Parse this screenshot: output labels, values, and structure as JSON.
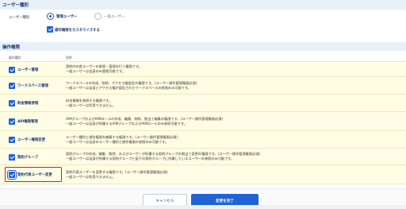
{
  "user_type": {
    "section_title": "ユーザー種別",
    "field_label": "ユーザー種別",
    "options": [
      {
        "label": "管理ユーザー",
        "selected": true
      },
      {
        "label": "一般ユーザー",
        "selected": false
      }
    ],
    "customize_label": "操作権限をカスタマイズする"
  },
  "permissions": {
    "section_title": "操作権限",
    "col_type": "操作種別",
    "col_desc": "説明",
    "rows": [
      {
        "name": "ユーザー管理",
        "desc": [
          "契約内の各ユーザーの参照・管理を行う権限です。",
          "一般ユーザーは自身のみ管理可能です。"
        ]
      },
      {
        "name": "ワークスペース管理",
        "desc": [
          "ワークスペースの作成、削除、アクセス権設定の権限です。(ユーザー操作管理権限必須)",
          "一般ユーザーは自身とアクセス権が設定されたワークスペースの参照のみ可能です。"
        ]
      },
      {
        "name": "料金情報参照",
        "desc": [
          "料金情報を参照する権限です。",
          "一般ユーザーは利用できません。"
        ]
      },
      {
        "name": "API権限管理",
        "desc": [
          "IAMグループおよびIAMロールの作成、編集、削除、割当て編集の権限です。(ユーザー操作管理権限必須)",
          "一般ユーザーは自身が所属するIAMグループおよびIAMロールのみ参照可能です。"
        ]
      },
      {
        "name": "ユーザー権限変更",
        "desc": [
          "ユーザー種別と操作権限を編集する権限です。(ユーザー操作管理権限必須)",
          "一般ユーザーは自身のユーザー種別と操作権限の参照のみ可能です。"
        ]
      },
      {
        "name": "契約グループ",
        "desc": [
          "契約グループの作成、編集、削除、およびユーザーが所属する契約グループの割当て変更の権限です。(ユーザー操作管理権限必須)",
          "一般ユーザーは自身が所属する契約グループと配下の契約グループに所属しているユーザーの参照のみ可能です。"
        ]
      },
      {
        "name": "契約代表ユーザー変更",
        "desc": [
          "契約代表ユーザーを変更する権限です。(ユーザー操作管理権限必須)",
          "一般ユーザーは利用できません。"
        ]
      }
    ]
  },
  "footer": {
    "cancel_label": "キャンセル",
    "finish_label": "変更を完了"
  },
  "colors": {
    "accent": "#1f63d5",
    "row_background": "#fffde4",
    "highlight": "#d21f1f"
  }
}
